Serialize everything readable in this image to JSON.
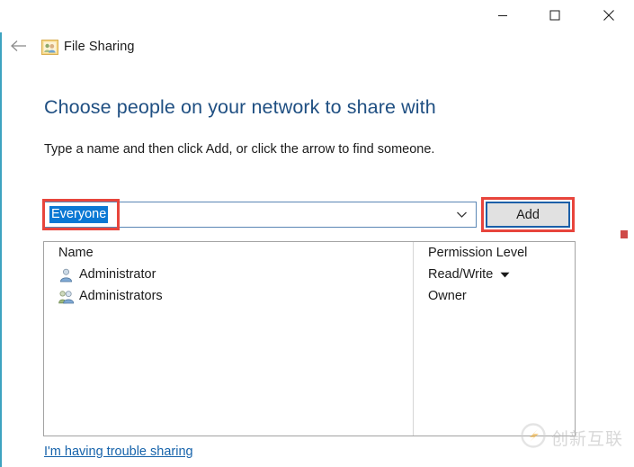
{
  "window": {
    "title": "File Sharing",
    "app_icon": "file-sharing-people-icon",
    "back_icon": "back-arrow-icon",
    "controls": {
      "minimize": "minimize-icon",
      "maximize": "maximize-icon",
      "close": "close-icon"
    }
  },
  "content": {
    "heading": "Choose people on your network to share with",
    "subheading": "Type a name and then click Add, or click the arrow to find someone."
  },
  "combo": {
    "value": "Everyone",
    "placeholder": "",
    "arrow_icon": "chevron-down-icon"
  },
  "add_button": {
    "label": "Add"
  },
  "list": {
    "columns": [
      "Name",
      "Permission Level"
    ],
    "rows": [
      {
        "name": "Administrator",
        "icon": "user-icon",
        "permission": "Read/Write",
        "permission_has_dropdown": true
      },
      {
        "name": "Administrators",
        "icon": "group-users-icon",
        "permission": "Owner",
        "permission_has_dropdown": false
      }
    ]
  },
  "footer": {
    "trouble_link": "I'm having trouble sharing"
  },
  "watermark": {
    "text": "创新互联",
    "logo_icon": "brand-circle-logo-icon"
  },
  "colors": {
    "heading_blue": "#1f4f82",
    "link_blue": "#1663ab",
    "selection_blue": "#0a78d4",
    "annotation_red": "#e8453c",
    "focus_border_blue": "#1b5fa8",
    "window_edge_teal": "#3da3c0"
  }
}
